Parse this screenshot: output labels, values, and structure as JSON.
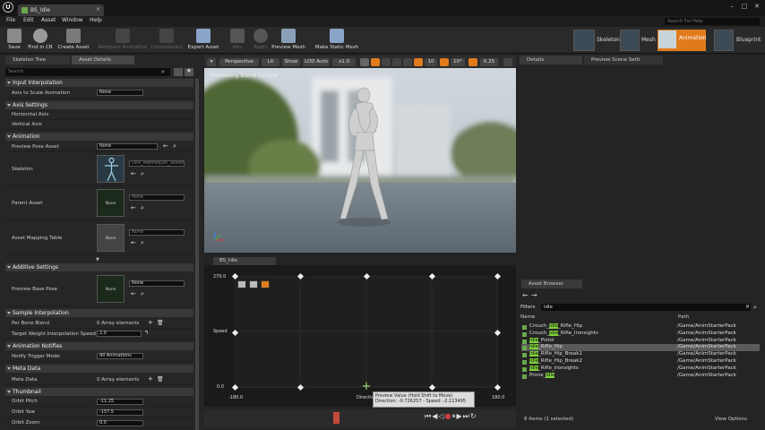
{
  "window": {
    "doc_tab": "BS_Idle",
    "logo": "U"
  },
  "menu": [
    "File",
    "Edit",
    "Asset",
    "Window",
    "Help"
  ],
  "help_search_placeholder": "Search For Help",
  "toolbar": {
    "buttons": [
      "Save",
      "Find in CB",
      "Create Asset",
      "Reimport Animation",
      "Compression",
      "Export Asset",
      "Key",
      "Apply",
      "Preview Mesh",
      "Make Static Mesh"
    ],
    "modes": [
      "Skeleton",
      "Mesh",
      "Animation",
      "Blueprint"
    ]
  },
  "left_panel": {
    "tabs": [
      "Skeleton Tree",
      "Asset Details"
    ],
    "search_placeholder": "Search",
    "sections": {
      "input_interpolation": "Input Interpolation",
      "axis_settings": "Axis Settings",
      "animation": "Animation",
      "additive_settings": "Additive Settings",
      "sample_interpolation": "Sample Interpolation",
      "animation_notifies": "Animation Notifies",
      "meta_data": "Meta Data",
      "thumbnail": "Thumbnail"
    },
    "props": {
      "axis_to_scale_label": "Axis to Scale Animation",
      "axis_to_scale_value": "None",
      "horizontal_axis": "Horizontal Axis",
      "vertical_axis": "Vertical Axis",
      "preview_pose_label": "Preview Pose Asset",
      "preview_pose_value": "None",
      "skeleton_label": "Skeleton",
      "skeleton_value": "UE4_Mannequin_Skeleton",
      "parent_asset_label": "Parent Asset",
      "parent_asset_value": "None",
      "mapping_label": "Asset Mapping Table",
      "mapping_value": "None",
      "thumb_none": "None",
      "preview_base_label": "Preview Base Pose",
      "preview_base_value": "None",
      "per_bone_label": "Per Bone Blend",
      "per_bone_value": "0 Array elements",
      "target_weight_label": "Target Weight Interpolation Speed Per",
      "target_weight_value": "2.0",
      "notify_label": "Notify Trigger Mode",
      "notify_value": "All Animations",
      "meta_label": "Meta Data",
      "meta_value": "0 Array elements",
      "orbit_pitch_label": "Orbit Pitch",
      "orbit_pitch_value": "-11.25",
      "orbit_yaw_label": "Orbit Yaw",
      "orbit_yaw_value": "-157.5",
      "orbit_zoom_label": "Orbit Zoom",
      "orbit_zoom_value": "0.0"
    }
  },
  "viewport": {
    "buttons": [
      "Perspective",
      "Lit",
      "Show",
      "LOD Auto",
      "x1.0",
      "10",
      "10°",
      "0.25"
    ],
    "overlay": "Previewing Blend Sample"
  },
  "blendspace": {
    "tab": "BS_Idle",
    "y_max": "270.0",
    "y_min": "0.0",
    "y_label": "Speed",
    "x_min": "-180.0",
    "x_max": "180.0",
    "x_label": "Direction",
    "tooltip_line1": "Preview Value (Hold Shift to Move)",
    "tooltip_line2": "Direction: -0.726257 - Speed: -2.113495"
  },
  "right_panel": {
    "tabs": [
      "Details",
      "Preview Scene Setti"
    ],
    "asset_browser_tab": "Asset Browser",
    "filters_label": "Filters",
    "filter_value": "idle",
    "col_name": "Name",
    "col_path": "Path",
    "assets": [
      {
        "pre": "Crouch_",
        "hit": "Idle",
        "post": "_Rifle_Hip",
        "path": "/Game/AnimStarterPack"
      },
      {
        "pre": "Crouch_",
        "hit": "Idle",
        "post": "_Rifle_Ironsights",
        "path": "/Game/AnimStarterPack"
      },
      {
        "pre": "",
        "hit": "Idle",
        "post": "_Pistol",
        "path": "/Game/AnimStarterPack"
      },
      {
        "pre": "",
        "hit": "Idle",
        "post": "_Rifle_Hip",
        "path": "/Game/AnimStarterPack"
      },
      {
        "pre": "",
        "hit": "Idle",
        "post": "_Rifle_Hip_Break1",
        "path": "/Game/AnimStarterPack"
      },
      {
        "pre": "",
        "hit": "Idle",
        "post": "_Rifle_Hip_Break2",
        "path": "/Game/AnimStarterPack"
      },
      {
        "pre": "",
        "hit": "Idle",
        "post": "_Rifle_Ironsights",
        "path": "/Game/AnimStarterPack"
      },
      {
        "pre": "Prone_",
        "hit": "Idle",
        "post": "",
        "path": "/Game/AnimStarterPack"
      }
    ],
    "selected_index": 3,
    "status": "8 items (1 selected)",
    "view_options": "View Options"
  },
  "colors": {
    "accent": "#e07b1c",
    "highlight": "#7fd13b",
    "selection": "#5a5a5a"
  }
}
